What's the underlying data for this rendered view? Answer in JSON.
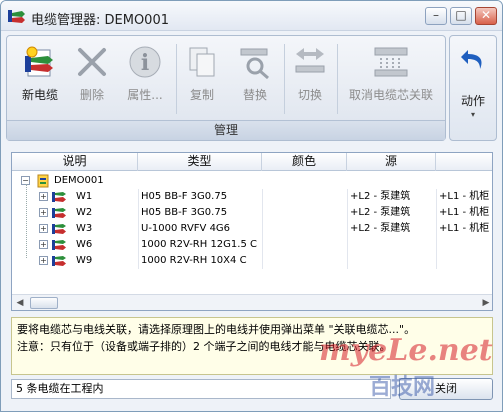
{
  "window": {
    "title": "电缆管理器: DEMO001",
    "minimize": "–",
    "maximize": "□",
    "close": "✕"
  },
  "ribbon": {
    "buttons": [
      {
        "label": "新电缆",
        "icon": "new-cable-icon",
        "enabled": true
      },
      {
        "label": "删除",
        "icon": "delete-icon",
        "enabled": false
      },
      {
        "label": "属性...",
        "icon": "properties-icon",
        "enabled": false
      },
      {
        "label": "复制",
        "icon": "copy-icon",
        "enabled": false
      },
      {
        "label": "替换",
        "icon": "replace-icon",
        "enabled": false
      },
      {
        "label": "切换",
        "icon": "switch-icon",
        "enabled": false
      },
      {
        "label": "取消电缆芯关联",
        "icon": "unlink-cores-icon",
        "enabled": false
      }
    ],
    "group_label": "管理",
    "action": {
      "label": "动作",
      "arrow": "▾"
    }
  },
  "table": {
    "columns": [
      "说明",
      "类型",
      "颜色",
      "源",
      ""
    ],
    "root": "DEMO001",
    "rows": [
      {
        "name": "W1",
        "type": "H05 BB-F 3G0.75",
        "color": "",
        "source": "+L2 - 泵建筑",
        "target": "+L1 - 机柜"
      },
      {
        "name": "W2",
        "type": "H05 BB-F 3G0.75",
        "color": "",
        "source": "+L2 - 泵建筑",
        "target": "+L1 - 机柜"
      },
      {
        "name": "W3",
        "type": "U-1000 RVFV 4G6",
        "color": "",
        "source": "+L2 - 泵建筑",
        "target": "+L1 - 机柜"
      },
      {
        "name": "W6",
        "type": "1000 R2V-RH 12G1.5 C",
        "color": "",
        "source": "",
        "target": ""
      },
      {
        "name": "W9",
        "type": "1000 R2V-RH 10X4 C",
        "color": "",
        "source": "",
        "target": ""
      }
    ]
  },
  "info": {
    "line1": "要将电缆芯与电线关联，请选择原理图上的电线并使用弹出菜单 \"关联电缆芯...\"。",
    "line2": "注意：只有位于（设备或端子排的）2 个端子之间的电线才能与电缆芯关联。"
  },
  "status": {
    "text": "5 条电缆在工程内"
  },
  "close_button": {
    "label": "关闭"
  },
  "watermark": {
    "text1": "myeLe.net",
    "text2": "百技网"
  },
  "colors": {
    "accent": "#1f5fbf",
    "frame": "#7f9db9",
    "info_bg": "#fffee8"
  }
}
